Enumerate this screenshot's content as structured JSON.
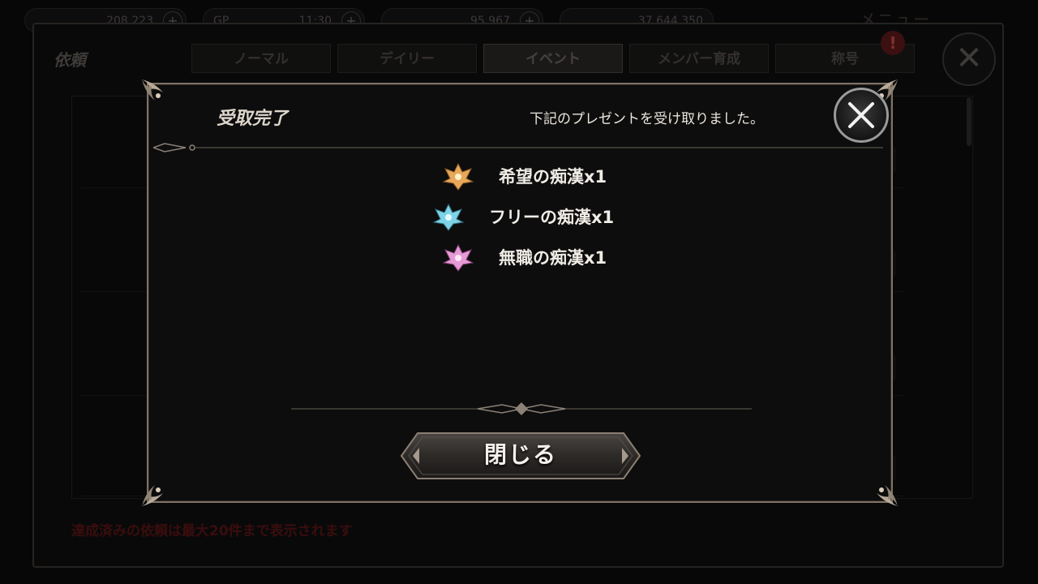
{
  "background": {
    "hud": {
      "stamina_value": "208,223",
      "gp_label": "GP",
      "gp_value": "11:30",
      "currency_value": "95,967",
      "gold_value": "37,644,350",
      "menu_label": "メニュー"
    },
    "screen_title": "依頼",
    "tabs": [
      {
        "label": "ノーマル",
        "active": false
      },
      {
        "label": "デイリー",
        "active": false
      },
      {
        "label": "イベント",
        "active": true
      },
      {
        "label": "メンバー育成",
        "active": false
      },
      {
        "label": "称号",
        "active": false
      }
    ],
    "alert_icon": "!",
    "close_glyph": "✕",
    "footer_note": "達成済みの依頼は最大20件まで表示されます"
  },
  "dialog": {
    "title": "受取完了",
    "message": "下記のプレゼントを受け取りました。",
    "rewards": [
      {
        "label": "希望の痴漢x1",
        "icon": "gold-crest-icon",
        "color": "#e7a85a"
      },
      {
        "label": "フリーの痴漢x1",
        "icon": "cyan-crest-icon",
        "color": "#7fd3e6"
      },
      {
        "label": "無職の痴漢x1",
        "icon": "pink-crest-icon",
        "color": "#e59ad6"
      }
    ],
    "ok_button_label": "閉じる"
  },
  "colors": {
    "frame": "#7f7265",
    "dialog_bg": "#0d0d0d",
    "text": "#ece6de",
    "footer_note": "#5a1414"
  }
}
